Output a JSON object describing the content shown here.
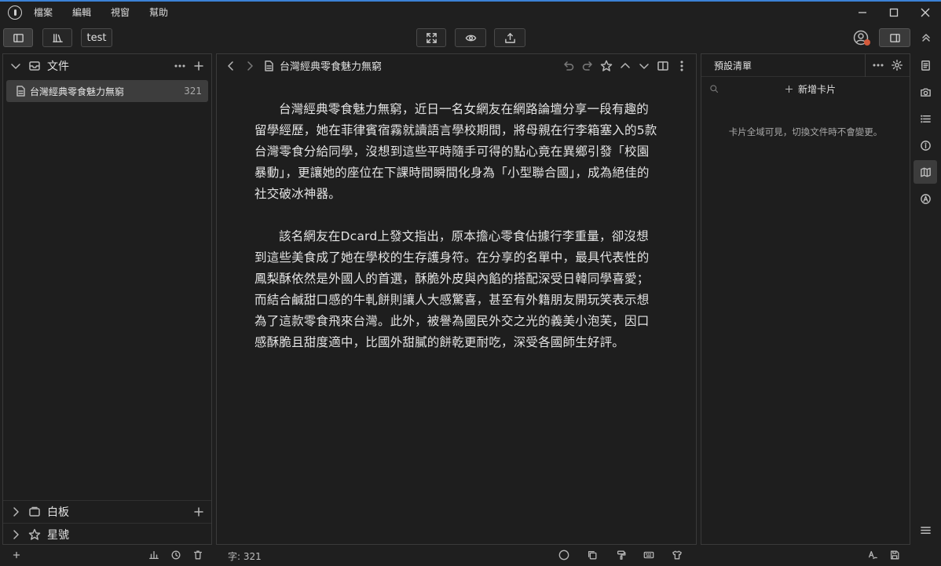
{
  "menubar": {
    "items": [
      "檔案",
      "編輯",
      "視窗",
      "幫助"
    ]
  },
  "toolbar": {
    "tab_label": "test"
  },
  "left_panel": {
    "files_section": "文件",
    "file": {
      "name": "台灣經典零食魅力無窮",
      "count": "321"
    },
    "whiteboard_section": "白板",
    "starred_section": "星號"
  },
  "editor": {
    "title": "台灣經典零食魅力無窮",
    "paragraphs": [
      "台灣經典零食魅力無窮，近日一名女網友在網路論壇分享一段有趣的留學經歷，她在菲律賓宿霧就讀語言學校期間，將母親在行李箱塞入的5款台灣零食分給同學，沒想到這些平時隨手可得的點心竟在異鄉引發「校園暴動」，更讓她的座位在下課時間瞬間化身為「小型聯合國」，成為絕佳的社交破冰神器。",
      "該名網友在Dcard上發文指出，原本擔心零食佔據行李重量，卻沒想到這些美食成了她在學校的生存護身符。在分享的名單中，最具代表性的鳳梨酥依然是外國人的首選，酥脆外皮與內餡的搭配深受日韓同學喜愛；而結合鹹甜口感的牛軋餅則讓人大感驚喜，甚至有外籍朋友開玩笑表示想為了這款零食飛來台灣。此外，被譽為國民外交之光的義美小泡芙，因口感酥脆且甜度適中，比國外甜膩的餅乾更耐吃，深受各國師生好評。"
    ]
  },
  "right_panel": {
    "title": "預設清單",
    "add_card": "新增卡片",
    "message": "卡片全域可見，切換文件時不會變更。"
  },
  "statusbar": {
    "word_count": "字: 321"
  },
  "colors": {
    "accent": "#3b82d6",
    "background": "#1f1f1f",
    "panel": "#1e1e1e",
    "selected": "#3d3d3d"
  }
}
